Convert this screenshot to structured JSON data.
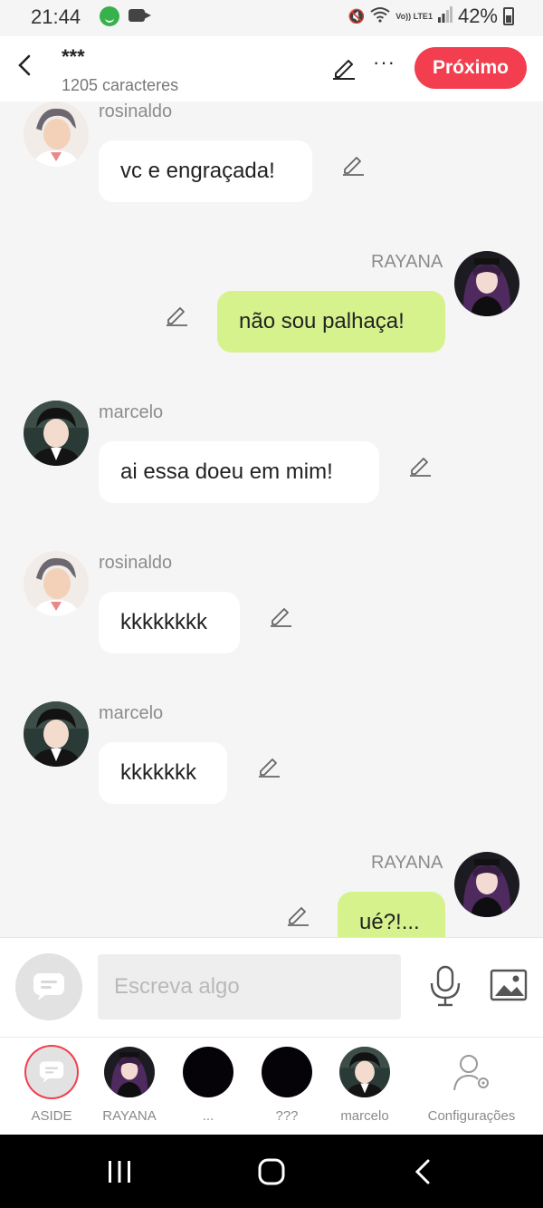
{
  "status_bar": {
    "time": "21:44",
    "network": "Vo)) LTE1",
    "battery": "42%"
  },
  "header": {
    "title": "***",
    "char_count": "1205 caracteres",
    "next_label": "Próximo"
  },
  "messages": [
    {
      "sender": "rosinaldo",
      "text": "vc e engraçada!",
      "side": "left"
    },
    {
      "sender": "RAYANA",
      "text": "não sou palhaça!",
      "side": "right"
    },
    {
      "sender": "marcelo",
      "text": "ai essa doeu em mim!",
      "side": "left"
    },
    {
      "sender": "rosinaldo",
      "text": "kkkkkkkk",
      "side": "left"
    },
    {
      "sender": "marcelo",
      "text": "kkkkkkk",
      "side": "left"
    },
    {
      "sender": "RAYANA",
      "text": "ué?!...",
      "side": "right"
    }
  ],
  "composer": {
    "placeholder": "Escreva algo"
  },
  "bottom_nav": [
    {
      "label": "ASIDE"
    },
    {
      "label": "RAYANA"
    },
    {
      "label": "..."
    },
    {
      "label": "???"
    },
    {
      "label": "marcelo"
    },
    {
      "label": "Configurações"
    }
  ],
  "colors": {
    "accent": "#f23e4f",
    "outgoing_bubble": "#d6f28c",
    "incoming_bubble": "#ffffff",
    "background": "#f5f5f5"
  }
}
